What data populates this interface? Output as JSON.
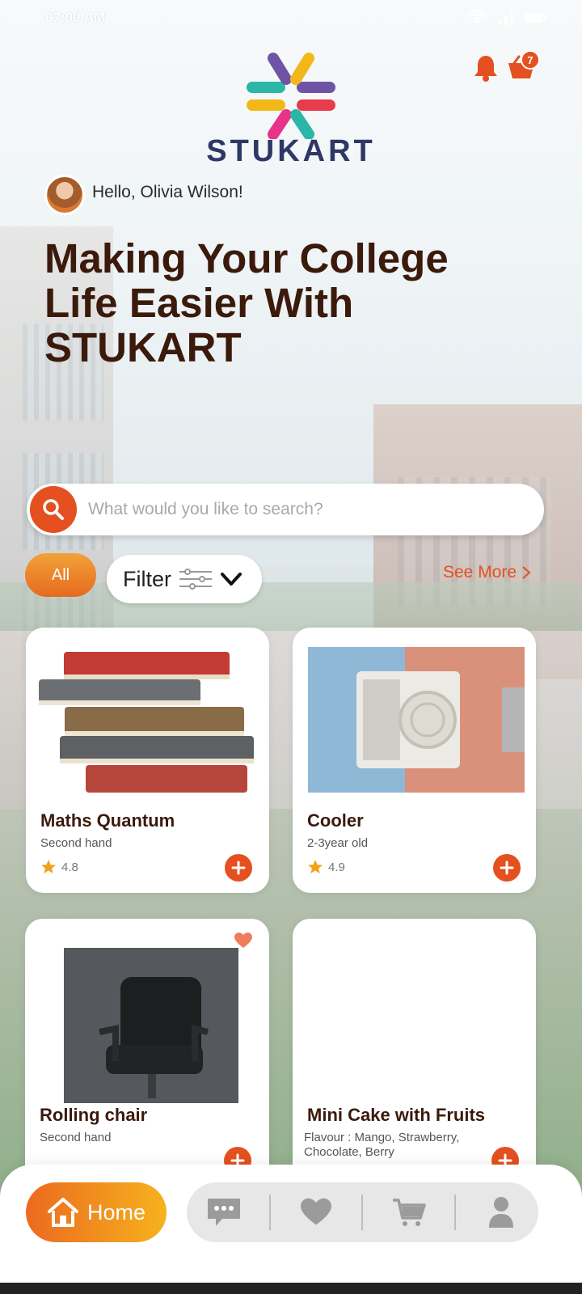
{
  "status_bar": {
    "time": "07:00 AM"
  },
  "header": {
    "brand_name": "STUKART",
    "cart_count": "7"
  },
  "greeting": {
    "text": "Hello, Olivia Wilson!"
  },
  "hero": {
    "line1": "Making Your College",
    "line2": "Life Easier With",
    "line3": "STUKART"
  },
  "search": {
    "placeholder": "What would you like to search?"
  },
  "filters": {
    "all_label": "All",
    "filter_label": "Filter",
    "see_more": "See More"
  },
  "products": [
    {
      "title": "Maths Quantum",
      "subtitle": "Second hand",
      "rating": "4.8"
    },
    {
      "title": "Cooler",
      "subtitle": "2-3year old",
      "rating": "4.9"
    },
    {
      "title": "Rolling chair",
      "subtitle": "Second hand"
    },
    {
      "title": "Mini Cake with Fruits",
      "subtitle": "Flavour : Mango, Strawberry, Chocolate, Berry"
    }
  ],
  "bottom_nav": {
    "home_label": "Home"
  },
  "colors": {
    "accent": "#e4501f",
    "headline": "#3b1a0c",
    "brand": "#2e3766",
    "gradient_start": "#ec6a1f",
    "gradient_end": "#f6b21e"
  },
  "icons": [
    "bell-icon",
    "basket-icon",
    "search-icon",
    "sliders-icon",
    "chevron-down-icon",
    "chevron-right-icon",
    "star-icon",
    "plus-icon",
    "heart-icon",
    "home-icon",
    "chat-icon",
    "cart-icon",
    "user-icon"
  ]
}
